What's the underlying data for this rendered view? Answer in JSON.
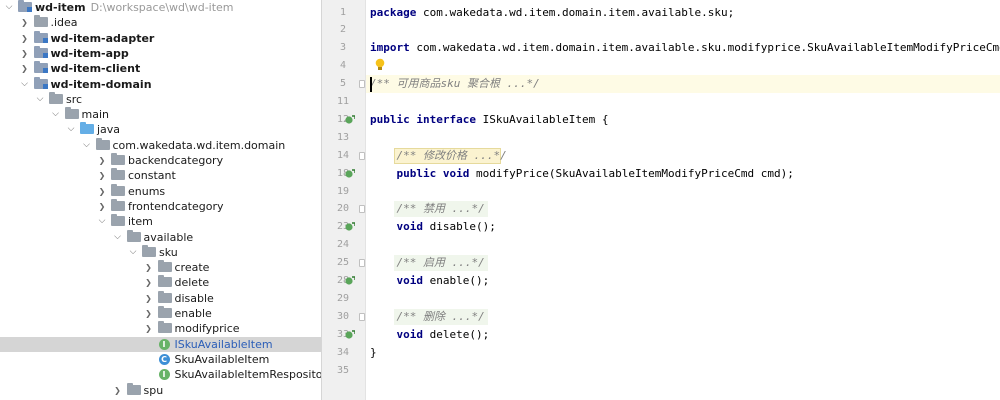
{
  "project": {
    "root": {
      "name": "wd-item",
      "path": "D:\\workspace\\wd\\wd-item"
    },
    "items": [
      {
        "label": "wd-item",
        "level": 0,
        "open": true,
        "icon": "folder-mod",
        "bold": true,
        "path": "D:\\workspace\\wd\\wd-item"
      },
      {
        "label": ".idea",
        "level": 1,
        "open": false,
        "icon": "folder-gray"
      },
      {
        "label": "wd-item-adapter",
        "level": 1,
        "open": false,
        "icon": "folder-mod",
        "bold": true
      },
      {
        "label": "wd-item-app",
        "level": 1,
        "open": false,
        "icon": "folder-mod",
        "bold": true
      },
      {
        "label": "wd-item-client",
        "level": 1,
        "open": false,
        "icon": "folder-mod",
        "bold": true
      },
      {
        "label": "wd-item-domain",
        "level": 1,
        "open": true,
        "icon": "folder-mod",
        "bold": true
      },
      {
        "label": "src",
        "level": 2,
        "open": true,
        "icon": "folder-gray"
      },
      {
        "label": "main",
        "level": 3,
        "open": true,
        "icon": "folder-gray"
      },
      {
        "label": "java",
        "level": 4,
        "open": true,
        "icon": "folder-blue"
      },
      {
        "label": "com.wakedata.wd.item.domain",
        "level": 5,
        "open": true,
        "icon": "folder-gray"
      },
      {
        "label": "backendcategory",
        "level": 6,
        "open": false,
        "icon": "folder-gray"
      },
      {
        "label": "constant",
        "level": 6,
        "open": false,
        "icon": "folder-gray"
      },
      {
        "label": "enums",
        "level": 6,
        "open": false,
        "icon": "folder-gray"
      },
      {
        "label": "frontendcategory",
        "level": 6,
        "open": false,
        "icon": "folder-gray"
      },
      {
        "label": "item",
        "level": 6,
        "open": true,
        "icon": "folder-gray"
      },
      {
        "label": "available",
        "level": 7,
        "open": true,
        "icon": "folder-gray"
      },
      {
        "label": "sku",
        "level": 8,
        "open": true,
        "icon": "folder-gray"
      },
      {
        "label": "create",
        "level": 9,
        "open": false,
        "icon": "folder-gray"
      },
      {
        "label": "delete",
        "level": 9,
        "open": false,
        "icon": "folder-gray"
      },
      {
        "label": "disable",
        "level": 9,
        "open": false,
        "icon": "folder-gray"
      },
      {
        "label": "enable",
        "level": 9,
        "open": false,
        "icon": "folder-gray"
      },
      {
        "label": "modifyprice",
        "level": 9,
        "open": false,
        "icon": "folder-gray"
      },
      {
        "label": "ISkuAvailableItem",
        "level": 9,
        "leaf": true,
        "icon": "interface",
        "selected": true
      },
      {
        "label": "SkuAvailableItem",
        "level": 9,
        "leaf": true,
        "icon": "class"
      },
      {
        "label": "SkuAvailableItemRespository",
        "level": 9,
        "leaf": true,
        "icon": "interface"
      },
      {
        "label": "spu",
        "level": 7,
        "open": false,
        "icon": "folder-gray"
      }
    ]
  },
  "editor": {
    "lines": [
      {
        "n": "1",
        "tokens": [
          {
            "t": "package",
            "c": "kw"
          },
          {
            "t": " com.wakedata.wd.item.domain.item.available.sku;"
          }
        ]
      },
      {
        "n": "2",
        "tokens": []
      },
      {
        "n": "3",
        "tokens": [
          {
            "t": "import",
            "c": "kw"
          },
          {
            "t": " com.wakedata.wd.item.domain.item.available.sku.modifyprice.SkuAvailableItemModifyPriceCmd;"
          }
        ]
      },
      {
        "n": "4",
        "tokens": [],
        "bulb": true
      },
      {
        "n": "5",
        "tokens": [
          {
            "t": "/** 可用商品sku 聚合根 ...*/",
            "c": "cm"
          }
        ],
        "current": true,
        "caret": true,
        "fold": true
      },
      {
        "n": "11",
        "tokens": []
      },
      {
        "n": "12",
        "tokens": [
          {
            "t": "public",
            "c": "kw"
          },
          {
            "t": " "
          },
          {
            "t": "interface",
            "c": "kw"
          },
          {
            "t": " ISkuAvailableItem {"
          }
        ],
        "impl": true
      },
      {
        "n": "13",
        "tokens": []
      },
      {
        "n": "14",
        "tokens": [
          {
            "t": "    "
          },
          {
            "t": "/** 修改价格 ...*/",
            "c": "cm",
            "box": "y"
          }
        ],
        "fold": true
      },
      {
        "n": "18",
        "tokens": [
          {
            "t": "    "
          },
          {
            "t": "public",
            "c": "kw"
          },
          {
            "t": " "
          },
          {
            "t": "void",
            "c": "kw"
          },
          {
            "t": " modifyPrice(SkuAvailableItemModifyPriceCmd cmd);"
          }
        ],
        "impl": true
      },
      {
        "n": "19",
        "tokens": []
      },
      {
        "n": "20",
        "tokens": [
          {
            "t": "    "
          },
          {
            "t": "/** 禁用 ...*/",
            "c": "cm",
            "box": "g"
          }
        ],
        "fold": true
      },
      {
        "n": "23",
        "tokens": [
          {
            "t": "    "
          },
          {
            "t": "void",
            "c": "kw"
          },
          {
            "t": " disable();"
          }
        ],
        "impl": true
      },
      {
        "n": "24",
        "tokens": []
      },
      {
        "n": "25",
        "tokens": [
          {
            "t": "    "
          },
          {
            "t": "/** 启用 ...*/",
            "c": "cm",
            "box": "g"
          }
        ],
        "fold": true
      },
      {
        "n": "28",
        "tokens": [
          {
            "t": "    "
          },
          {
            "t": "void",
            "c": "kw"
          },
          {
            "t": " enable();"
          }
        ],
        "impl": true
      },
      {
        "n": "29",
        "tokens": []
      },
      {
        "n": "30",
        "tokens": [
          {
            "t": "    "
          },
          {
            "t": "/** 删除 ...*/",
            "c": "cm",
            "box": "g"
          }
        ],
        "fold": true
      },
      {
        "n": "33",
        "tokens": [
          {
            "t": "    "
          },
          {
            "t": "void",
            "c": "kw"
          },
          {
            "t": " delete();"
          }
        ],
        "impl": true
      },
      {
        "n": "34",
        "tokens": [
          {
            "t": "}"
          }
        ]
      },
      {
        "n": "35",
        "tokens": []
      }
    ]
  }
}
